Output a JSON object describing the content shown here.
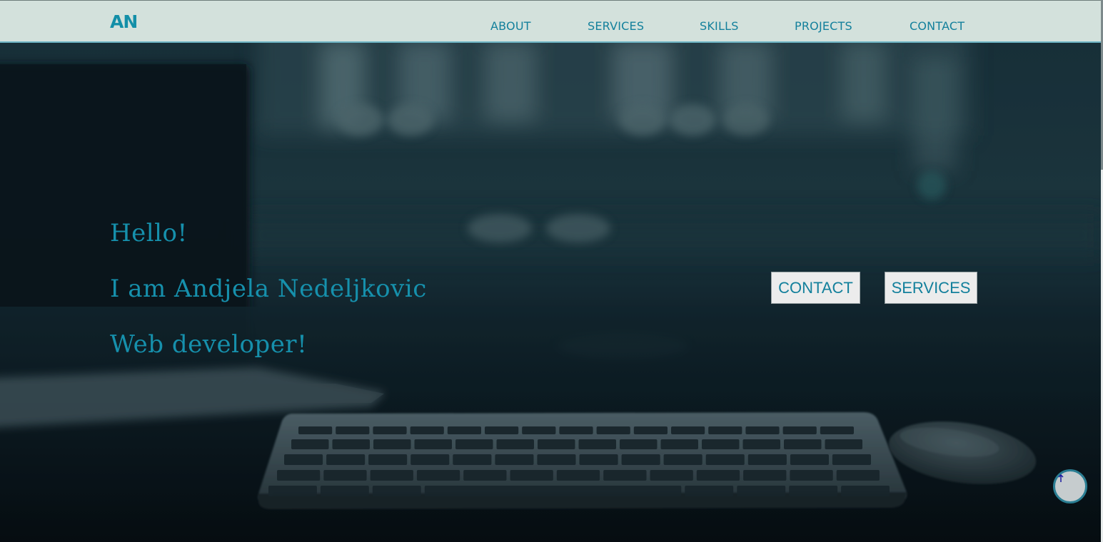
{
  "header": {
    "logo": "AN",
    "nav": [
      {
        "label": "ABOUT"
      },
      {
        "label": "SERVICES"
      },
      {
        "label": "SKILLS"
      },
      {
        "label": "PROJECTS"
      },
      {
        "label": "CONTACT"
      }
    ]
  },
  "hero": {
    "greeting": "Hello!",
    "intro": "I am Andjela Nedeljkovic",
    "role": "Web developer!",
    "buttons": {
      "contact": "CONTACT",
      "services": "SERVICES"
    }
  },
  "icons": {
    "back_to_top": "arrow-up-icon"
  },
  "colors": {
    "accent": "#1690ac",
    "nav_background": "#d3e1dc",
    "button_background": "#ececec"
  }
}
